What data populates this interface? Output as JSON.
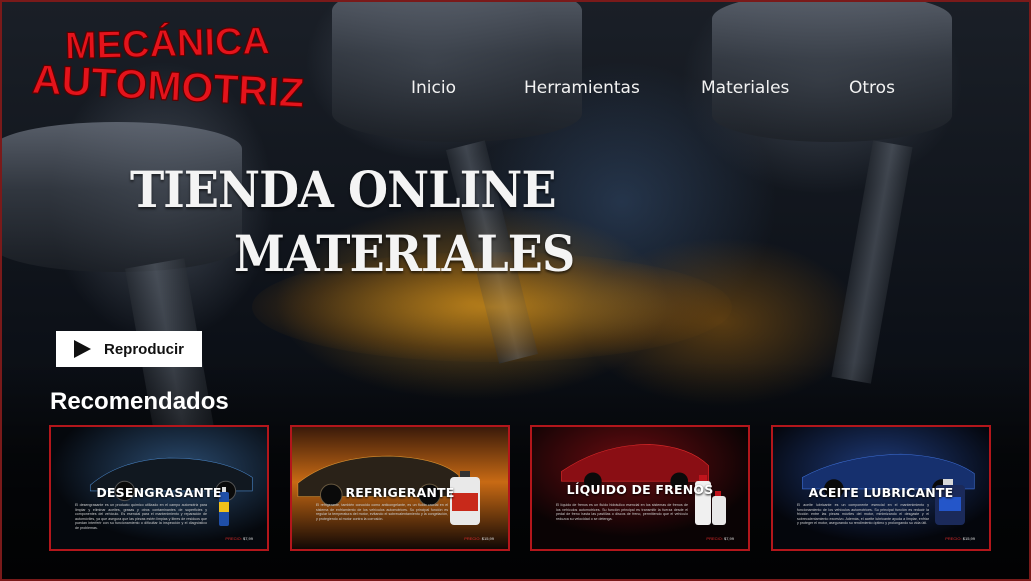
{
  "logo": {
    "line1": "MECÁNICA",
    "line2": "AUTOMOTRIZ"
  },
  "nav": {
    "items": [
      {
        "label": "Inicio"
      },
      {
        "label": "Herramientas"
      },
      {
        "label": "Materiales"
      },
      {
        "label": "Otros"
      }
    ]
  },
  "hero": {
    "line1": "TIENDA ONLINE",
    "line2": "MATERIALES"
  },
  "play_button": {
    "label": "Reproducir",
    "icon": "play-icon"
  },
  "section": {
    "title": "Recomendados"
  },
  "cards": [
    {
      "title": "DESENGRASANTE",
      "description": "El desengrasante es un producto químico utilizado en el campo automotriz para limpiar y eliminar aceites, grasas y otros contaminantes de superficies y componentes del vehículo. Es esencial para el mantenimiento y reparación de automóviles, ya que asegura que las piezas estén limpias y libres de residuos que puedan interferir con su funcionamiento o dificultar la inspección y el diagnóstico de problemas.",
      "price_label": "PRECIO:",
      "price": "$7,99",
      "product_icon": "spray-can-icon",
      "accent": "#3a7bd5"
    },
    {
      "title": "REFRIGERANTE",
      "description": "El refrigerante, también conocido como anticongelante, es un fluido crucial en el sistema de enfriamiento de los vehículos automotrices. Su principal función es regular la temperatura del motor, evitando el sobrecalentamiento y la congelación, y protegiendo al motor contra la corrosión.",
      "price_label": "PRECIO:",
      "price": "$15,99",
      "product_icon": "coolant-jug-icon",
      "accent": "#e07a10"
    },
    {
      "title": "LÍQUIDO DE FRENOS",
      "description": "El líquido de frenos es un fluido hidráulico esencial en los sistemas de frenos de los vehículos automotrices. Su función principal es transmitir la fuerza desde el pedal de freno hasta las pastillas o discos de freno, permitiendo que el vehículo reduzca su velocidad o se detenga.",
      "price_label": "PRECIO:",
      "price": "$7,99",
      "product_icon": "brake-fluid-bottles-icon",
      "accent": "#c0141c"
    },
    {
      "title": "ACEITE LUBRICANTE",
      "description": "El aceite lubricante es un componente esencial en el mantenimiento y funcionamiento de los vehículos automotrices. Su principal función es reducir la fricción entre las piezas móviles del motor, minimizando el desgaste y el sobrecalentamiento excesivo. Además, el aceite lubricante ayuda a limpiar, enfriar y proteger el motor, asegurando su rendimiento óptimo y prolongando su vida útil.",
      "price_label": "PRECIO:",
      "price": "$15,99",
      "product_icon": "oil-jug-icon",
      "accent": "#2456c9"
    }
  ],
  "colors": {
    "logo_red": "#e4131b",
    "card_border": "#b3161b",
    "price_label": "#e02b2b"
  }
}
